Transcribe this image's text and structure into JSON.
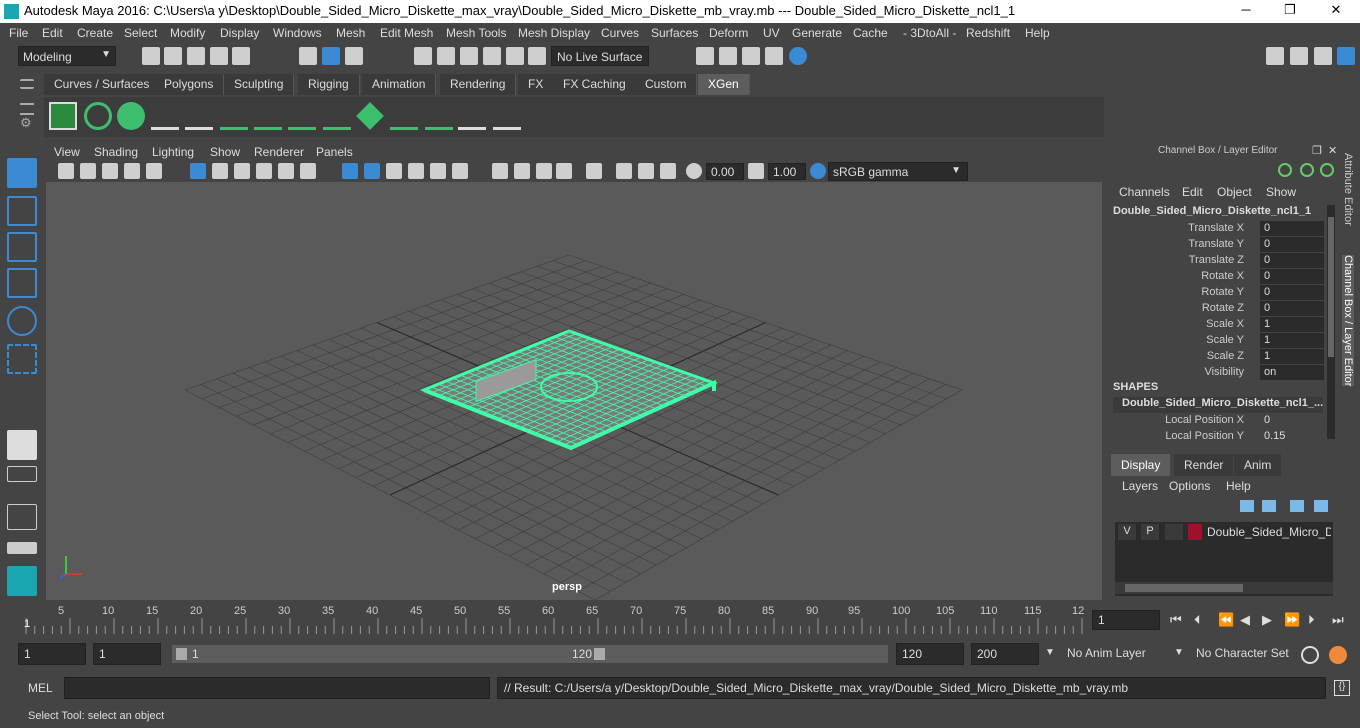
{
  "window": {
    "title": "Autodesk Maya 2016: C:\\Users\\a y\\Desktop\\Double_Sided_Micro_Diskette_max_vray\\Double_Sided_Micro_Diskette_mb_vray.mb   ---   Double_Sided_Micro_Diskette_ncl1_1",
    "minimize": "─",
    "maximize": "❐",
    "close": "✕"
  },
  "menubar": [
    "File",
    "Edit",
    "Create",
    "Select",
    "Modify",
    "Display",
    "Windows",
    "Mesh",
    "Edit Mesh",
    "Mesh Tools",
    "Mesh Display",
    "Curves",
    "Surfaces",
    "Deform",
    "UV",
    "Generate",
    "Cache",
    "- 3DtoAll -",
    "Redshift",
    "Help"
  ],
  "statusline": {
    "mode": "Modeling",
    "live_surface": "No Live Surface"
  },
  "shelf_tabs": [
    "Curves / Surfaces",
    "Polygons",
    "Sculpting",
    "Rigging",
    "Animation",
    "Rendering",
    "FX",
    "FX Caching",
    "Custom",
    "XGen"
  ],
  "shelf_active": "XGen",
  "panel": {
    "menus": [
      "View",
      "Shading",
      "Lighting",
      "Show",
      "Renderer",
      "Panels"
    ],
    "exposure": "0.00",
    "gamma": "1.00",
    "colorspace": "sRGB gamma",
    "camera_label": "persp"
  },
  "channel_box": {
    "header": "Channel Box / Layer Editor",
    "menus": [
      "Channels",
      "Edit",
      "Object",
      "Show"
    ],
    "object_name": "Double_Sided_Micro_Diskette_ncl1_1",
    "attributes": [
      {
        "label": "Translate X",
        "value": "0"
      },
      {
        "label": "Translate Y",
        "value": "0"
      },
      {
        "label": "Translate Z",
        "value": "0"
      },
      {
        "label": "Rotate X",
        "value": "0"
      },
      {
        "label": "Rotate Y",
        "value": "0"
      },
      {
        "label": "Rotate Z",
        "value": "0"
      },
      {
        "label": "Scale X",
        "value": "1"
      },
      {
        "label": "Scale Y",
        "value": "1"
      },
      {
        "label": "Scale Z",
        "value": "1"
      },
      {
        "label": "Visibility",
        "value": "on"
      }
    ],
    "shapes_title": "SHAPES",
    "shape_name": "Double_Sided_Micro_Diskette_ncl1_...",
    "shape_attributes": [
      {
        "label": "Local Position X",
        "value": "0"
      },
      {
        "label": "Local Position Y",
        "value": "0.15"
      }
    ]
  },
  "side_tabs": [
    "Attribute Editor",
    "Channel Box / Layer Editor"
  ],
  "layer_editor": {
    "tabs": [
      "Display",
      "Render",
      "Anim"
    ],
    "active_tab": "Display",
    "menus": [
      "Layers",
      "Options",
      "Help"
    ],
    "layer": {
      "v": "V",
      "p": "P",
      "name": "Double_Sided_Micro_Dis",
      "color": "#a0102a"
    }
  },
  "timeline": {
    "ticks": [
      "5",
      "10",
      "15",
      "20",
      "25",
      "30",
      "35",
      "40",
      "45",
      "50",
      "55",
      "60",
      "65",
      "70",
      "75",
      "80",
      "85",
      "90",
      "95",
      "100",
      "105",
      "110",
      "115",
      "12"
    ],
    "start_marker": "1",
    "current_frame": "1"
  },
  "range": {
    "start": "1",
    "playback_start": "1",
    "slider_start": "1",
    "slider_end": "120",
    "playback_end": "120",
    "end": "200",
    "anim_layer": "No Anim Layer",
    "character_set": "No Character Set"
  },
  "command": {
    "mel_label": "MEL",
    "result": "// Result: C:/Users/a y/Desktop/Double_Sided_Micro_Diskette_max_vray/Double_Sided_Micro_Diskette_mb_vray.mb"
  },
  "help_line": "Select Tool: select an object",
  "colors": {
    "wire": "#3dffa8",
    "accent": "#3a8ad4",
    "active_tab": "#5d5d5d"
  }
}
